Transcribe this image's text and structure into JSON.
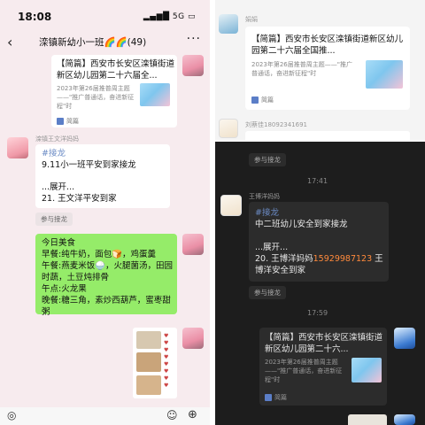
{
  "left": {
    "status_time": "18:08",
    "status_signal": "5G",
    "chat_title": "滦镇新幼小一班🌈🌈(49)",
    "link_card": {
      "title": "【简篇】西安市长安区滦镇街道新区幼儿园第二十六届全...",
      "sub": "2023年第26届推普周主题——\"推广普通话，奋进新征程\"时",
      "source": "简篇"
    },
    "sender1": "滦镇王文洋妈妈",
    "jielong": {
      "tag": "#接龙",
      "line1": "9.11小一班平安到家接龙",
      "expand": "...展开...",
      "entry": "21. 王文洋平安到家"
    },
    "quote1": "参与接龙",
    "menu": {
      "lines": [
        "今日美食",
        "早餐:纯牛奶，面包🍞，鸡蛋羹",
        "午餐:燕麦米饭🍚，火腿菌汤，田园时蔬，土豆炖排骨",
        "午点:火龙果",
        "晚餐:糖三角，素炒西葫芦，蜜枣甜粥"
      ]
    }
  },
  "right_top": {
    "sender": "娟娟",
    "card": {
      "title": "【简篇】西安市长安区滦镇街道新区幼儿园第二十六届全国推...",
      "sub": "2023年第26届推普周主题——\"推广普通话，奋进新征程\"时",
      "source": "简篇"
    },
    "sender2": "刘蔡佳18092341691",
    "quote": "参与接龙"
  },
  "right_bottom": {
    "time1": "17:41",
    "sender": "王博洋妈妈",
    "jielong": {
      "tag": "#接龙",
      "line1": "中二班幼儿安全到家接龙",
      "expand": "...展开...",
      "entry_prefix": "20. 王博洋妈妈",
      "entry_phone": "15929987123",
      "entry_suffix": " 王博洋安全到家"
    },
    "quote": "参与接龙",
    "time2": "17:59",
    "card": {
      "title": "【简篇】西安市长安区滦镇街道新区幼儿园第二十六...",
      "sub": "2023年第26届推普周主题——\"推广普通话，奋进新征程\"时",
      "source": "简篇"
    }
  }
}
